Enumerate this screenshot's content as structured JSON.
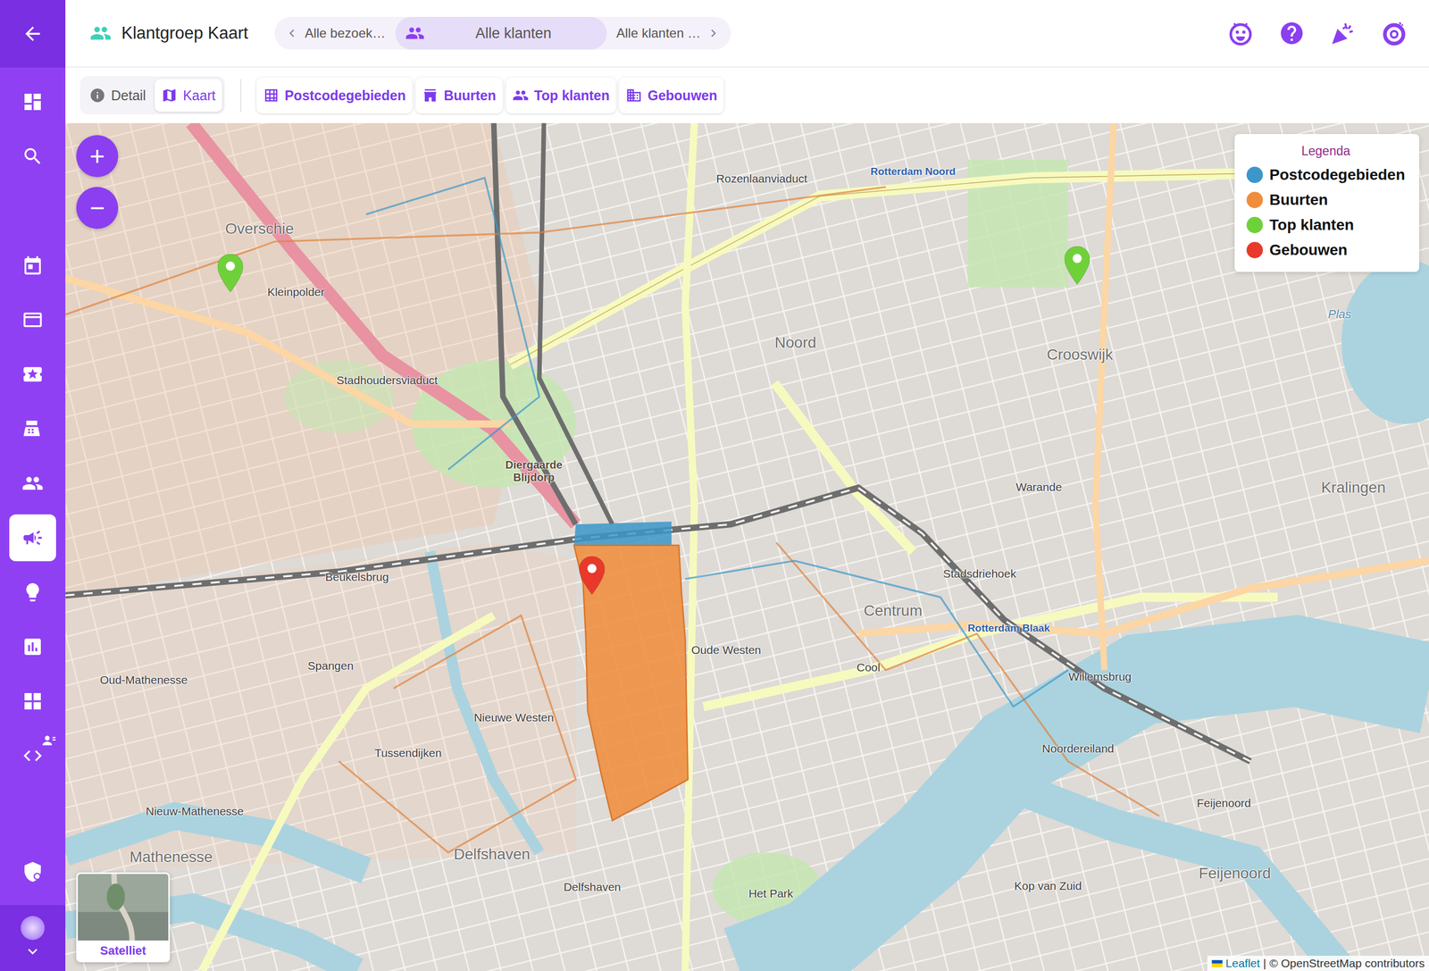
{
  "header": {
    "title": "Klantgroep Kaart"
  },
  "breadcrumb_tabs": [
    {
      "label": "Alle bezoek…",
      "selected": false
    },
    {
      "label": "Alle klanten",
      "selected": true
    },
    {
      "label": "Alle klanten …",
      "selected": false
    }
  ],
  "view_switch": [
    {
      "label": "Detail",
      "selected": false
    },
    {
      "label": "Kaart",
      "selected": true
    }
  ],
  "layer_buttons": [
    {
      "label": "Postcodegebieden"
    },
    {
      "label": "Buurten"
    },
    {
      "label": "Top klanten"
    },
    {
      "label": "Gebouwen"
    }
  ],
  "sidebar": {
    "items": [
      {
        "selected": false
      },
      {
        "selected": false
      },
      {
        "selected": false
      },
      {
        "selected": false
      },
      {
        "selected": false
      },
      {
        "selected": false
      },
      {
        "selected": false
      },
      {
        "selected": true
      },
      {
        "selected": false
      },
      {
        "selected": false
      },
      {
        "selected": false
      },
      {
        "selected": false
      }
    ]
  },
  "map": {
    "zoom_buttons": [
      "+",
      "−"
    ],
    "legend": {
      "title": "Legenda",
      "items": [
        {
          "label": "Postcodegebieden",
          "color": "#3b97c9"
        },
        {
          "label": "Buurten",
          "color": "#ef8d3d"
        },
        {
          "label": "Top klanten",
          "color": "#6fd13a"
        },
        {
          "label": "Gebouwen",
          "color": "#e8392b"
        }
      ]
    },
    "areas": [
      {
        "color": "#3b97c9"
      },
      {
        "color": "#ef8d3d"
      }
    ],
    "pins": [
      {
        "color": "#6fd13a"
      },
      {
        "color": "#e8392b"
      },
      {
        "color": "#6fd13a"
      }
    ],
    "labels": [
      {
        "text": "Overschie",
        "kind": "district"
      },
      {
        "text": "Kleinpolder",
        "kind": "street"
      },
      {
        "text": "Stadhoudersviaduct",
        "kind": "street"
      },
      {
        "text": "Diergaarde Blijdorp",
        "kind": "poi"
      },
      {
        "text": "Noord",
        "kind": "district"
      },
      {
        "text": "Crooswijk",
        "kind": "district"
      },
      {
        "text": "Kralingen",
        "kind": "district"
      },
      {
        "text": "Warande",
        "kind": "street"
      },
      {
        "text": "Stadsdriehoek",
        "kind": "street"
      },
      {
        "text": "Centrum",
        "kind": "district"
      },
      {
        "text": "Oude Westen",
        "kind": "street"
      },
      {
        "text": "Cool",
        "kind": "street"
      },
      {
        "text": "Willemsbrug",
        "kind": "street"
      },
      {
        "text": "Spangen",
        "kind": "street"
      },
      {
        "text": "Nieuwe Westen",
        "kind": "street"
      },
      {
        "text": "Tussendijken",
        "kind": "street"
      },
      {
        "text": "Oud-Mathenesse",
        "kind": "street"
      },
      {
        "text": "Nieuw-Mathenesse",
        "kind": "street"
      },
      {
        "text": "Mathenesse",
        "kind": "district"
      },
      {
        "text": "Delfshaven",
        "kind": "district"
      },
      {
        "text": "Delfshaven",
        "kind": "street"
      },
      {
        "text": "Noordereiland",
        "kind": "street"
      },
      {
        "text": "Feijenoord",
        "kind": "street"
      },
      {
        "text": "Feijenoord",
        "kind": "district"
      },
      {
        "text": "Kop van Zuid",
        "kind": "street"
      },
      {
        "text": "Rotterdam Noord",
        "kind": "station"
      },
      {
        "text": "Rotterdam Blaak",
        "kind": "station"
      },
      {
        "text": "Het Park",
        "kind": "street"
      },
      {
        "text": "Beukelsbrug",
        "kind": "street"
      },
      {
        "text": "Rozenlaanviaduct",
        "kind": "street"
      },
      {
        "text": "Plas",
        "kind": "water"
      }
    ],
    "satellite_toggle": {
      "label": "Satelliet"
    },
    "attribution": {
      "link": "Leaflet",
      "text": "| © OpenStreetMap contributors"
    }
  }
}
